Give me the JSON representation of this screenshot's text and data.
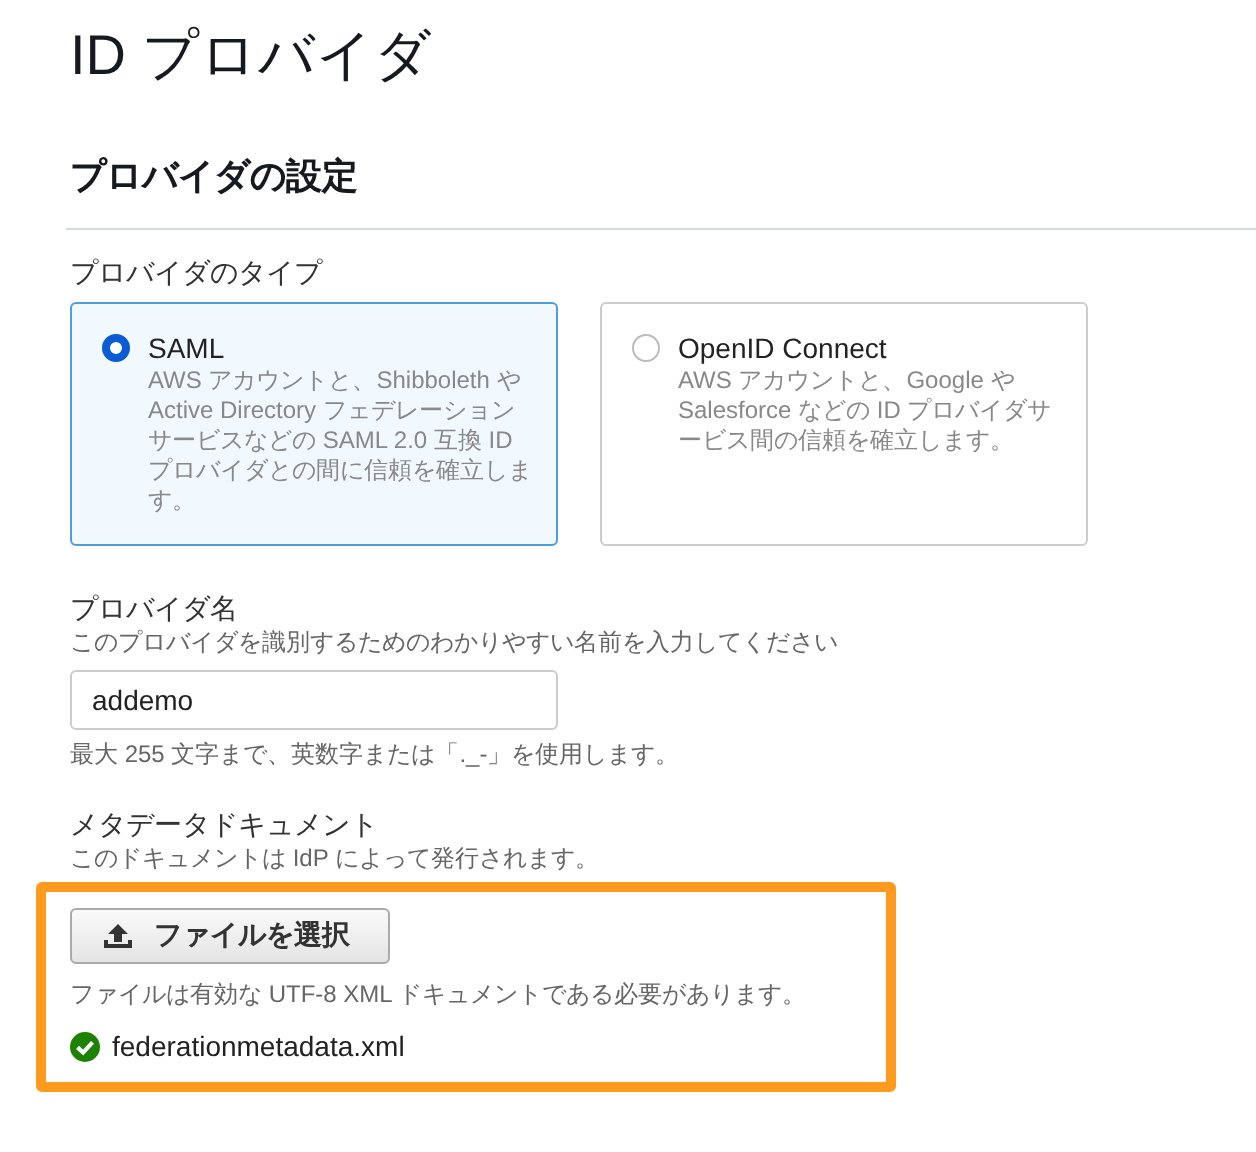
{
  "page_title": "ID プロバイダ",
  "section_title": "プロバイダの設定",
  "provider_type": {
    "label": "プロバイダのタイプ",
    "options": [
      {
        "name": "SAML",
        "description": "AWS アカウントと、Shibboleth や Active Directory フェデレーションサービスなどの SAML 2.0 互換 ID プロバイダとの間に信頼を確立します。",
        "selected": true
      },
      {
        "name": "OpenID Connect",
        "description": "AWS アカウントと、Google や Salesforce などの ID プロバイダサービス間の信頼を確立します。",
        "selected": false
      }
    ]
  },
  "provider_name": {
    "label": "プロバイダ名",
    "description": "このプロバイダを識別するためのわかりやすい名前を入力してください",
    "value": "addemo",
    "hint": "最大 255 文字まで、英数字または「._-」を使用します。"
  },
  "metadata": {
    "label": "メタデータドキュメント",
    "description": "このドキュメントは IdP によって発行されます。",
    "button": "ファイルを選択",
    "note": "ファイルは有効な UTF-8 XML ドキュメントである必要があります。",
    "file": "federationmetadata.xml"
  }
}
